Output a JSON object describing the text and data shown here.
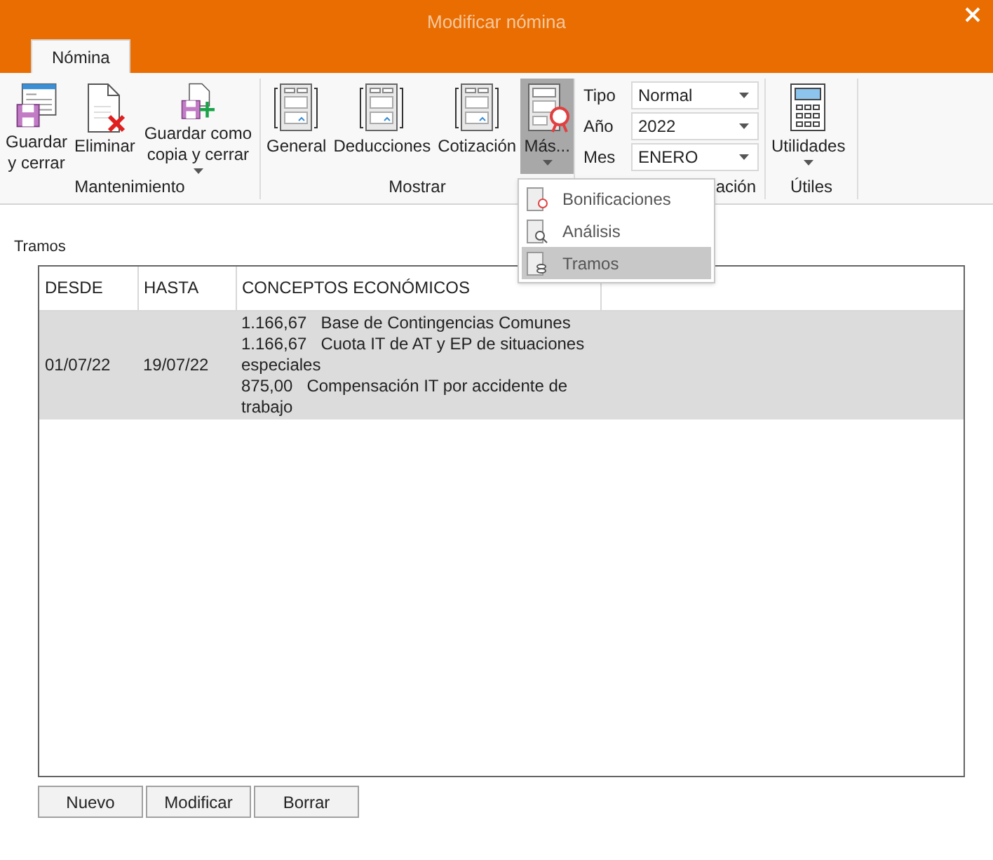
{
  "window": {
    "title": "Modificar nómina"
  },
  "tabs": [
    {
      "label": "Nómina",
      "selected": true
    }
  ],
  "ribbon": [
    {
      "label": "Mantenimiento",
      "buttons": [
        {
          "kind": "save",
          "label": "Guardar y cerrar",
          "dropdown": false,
          "pressed": false
        },
        {
          "kind": "delete",
          "label": "Eliminar",
          "dropdown": false,
          "pressed": false
        },
        {
          "kind": "save-copy",
          "label": "Guardar como copia y cerrar",
          "dropdown": true,
          "pressed": false
        }
      ]
    },
    {
      "label": "Mostrar",
      "buttons": [
        {
          "kind": "report",
          "label": "General",
          "dropdown": false,
          "pressed": false
        },
        {
          "kind": "report",
          "label": "Deducciones",
          "dropdown": false,
          "pressed": false
        },
        {
          "kind": "report",
          "label": "Cotización",
          "dropdown": false,
          "pressed": false
        },
        {
          "kind": "report-more",
          "label": "Más...",
          "dropdown": true,
          "pressed": true
        }
      ]
    },
    {
      "label": "ación",
      "fields": [
        {
          "label": "Tipo",
          "value": "Normal"
        },
        {
          "label": "Año",
          "value": "2022"
        },
        {
          "label": "Mes",
          "value": "ENERO"
        }
      ]
    },
    {
      "label": "Útiles",
      "buttons": [
        {
          "kind": "calculator",
          "label": "Utilidades",
          "dropdown": true,
          "pressed": false
        }
      ]
    }
  ],
  "menu": [
    {
      "kind": "bonus",
      "label": "Bonificaciones",
      "selected": false
    },
    {
      "kind": "analysis",
      "label": "Análisis",
      "selected": false
    },
    {
      "kind": "tramos",
      "label": "Tramos",
      "selected": true
    }
  ],
  "section_label": "Tramos",
  "table": {
    "columns": [
      "DESDE",
      "HASTA",
      "CONCEPTOS ECONÓMICOS"
    ],
    "rows": [
      {
        "selected": true,
        "desde": "01/07/22",
        "hasta": "19/07/22",
        "conceptos": [
          "1.166,67   Base de Contingencias Comunes",
          "1.166,67   Cuota IT de AT y EP de situaciones especiales",
          "875,00   Compensación IT por accidente de trabajo"
        ]
      }
    ]
  },
  "buttons": [
    "Nuevo",
    "Modificar",
    "Borrar"
  ]
}
